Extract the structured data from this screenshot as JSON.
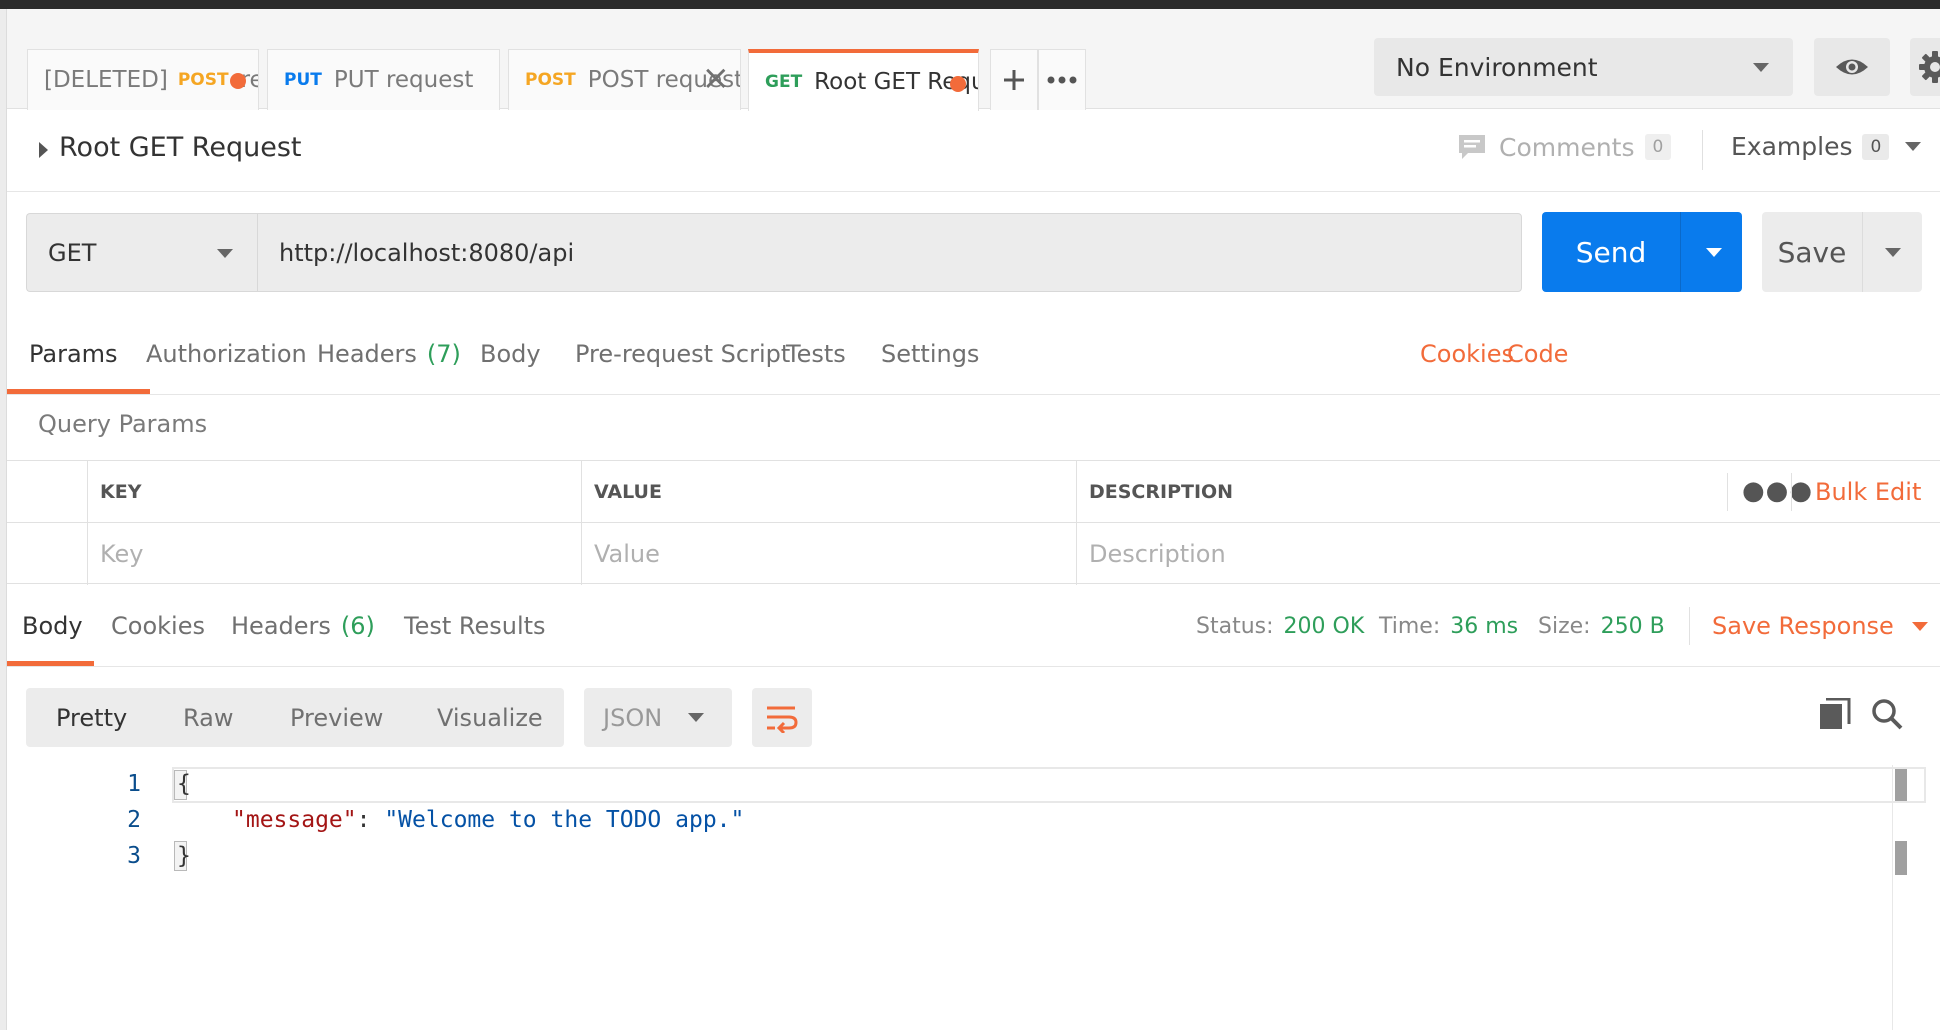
{
  "tabs": [
    {
      "deleted_prefix": "[DELETED]",
      "method": "POST",
      "name": "rem...",
      "unsaved": true
    },
    {
      "method": "PUT",
      "name": "PUT request"
    },
    {
      "method": "POST",
      "name": "POST request",
      "closable": true
    },
    {
      "method": "GET",
      "name": "Root GET Request",
      "unsaved": true,
      "active": true
    }
  ],
  "environment": {
    "selected": "No Environment"
  },
  "request": {
    "title": "Root GET Request",
    "comments_label": "Comments",
    "comments_count": "0",
    "examples_label": "Examples",
    "examples_count": "0",
    "method": "GET",
    "url": "http://localhost:8080/api",
    "send_label": "Send",
    "save_label": "Save"
  },
  "request_tabs": {
    "params": "Params",
    "authorization": "Authorization",
    "headers": "Headers",
    "headers_count": "(7)",
    "body": "Body",
    "prerequest": "Pre-request Script",
    "tests": "Tests",
    "settings": "Settings",
    "cookies": "Cookies",
    "code": "Code"
  },
  "query_params": {
    "label": "Query Params",
    "columns": [
      "KEY",
      "VALUE",
      "DESCRIPTION"
    ],
    "bulk_edit": "Bulk Edit",
    "placeholders": [
      "Key",
      "Value",
      "Description"
    ]
  },
  "response_tabs": {
    "body": "Body",
    "cookies": "Cookies",
    "headers": "Headers",
    "headers_count": "(6)",
    "test_results": "Test Results"
  },
  "response_status": {
    "status_label": "Status:",
    "status_value": "200 OK",
    "time_label": "Time:",
    "time_value": "36 ms",
    "size_label": "Size:",
    "size_value": "250 B",
    "save_response": "Save Response"
  },
  "response_view": {
    "modes": [
      "Pretty",
      "Raw",
      "Preview",
      "Visualize"
    ],
    "active_mode": "Pretty",
    "format": "JSON"
  },
  "response_body": {
    "line_numbers": [
      "1",
      "2",
      "3"
    ],
    "open_brace": "{",
    "key": "\"message\"",
    "colon": ": ",
    "value": "\"Welcome to the TODO app.\"",
    "close_brace": "}"
  },
  "icons": {
    "eye": "eye-icon",
    "gear": "gear-icon",
    "comment": "comment-icon",
    "wrap": "wrap-lines-icon",
    "copy": "copy-icon",
    "search": "search-icon"
  },
  "colors": {
    "accent": "#f26b3a",
    "send": "#097bed",
    "get": "#2e9e5a",
    "post": "#f5a623",
    "put": "#097bed"
  }
}
